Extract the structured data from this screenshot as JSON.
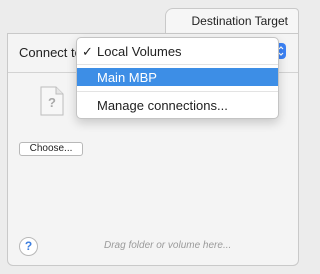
{
  "tab": {
    "label": "Destination Target"
  },
  "header": {
    "connect_label": "Connect to"
  },
  "menu": {
    "items": [
      {
        "label": "Local Volumes",
        "checked": true,
        "check_glyph": "✓"
      },
      {
        "label": "Main MBP",
        "checked": false,
        "highlighted": true
      },
      {
        "label": "Manage connections..."
      }
    ]
  },
  "body": {
    "choose_label": "Choose...",
    "drag_hint": "Drag folder or volume here...",
    "help_glyph": "?"
  },
  "colors": {
    "accent": "#3d8ee6",
    "popup_arrow": "#3b82f6"
  }
}
